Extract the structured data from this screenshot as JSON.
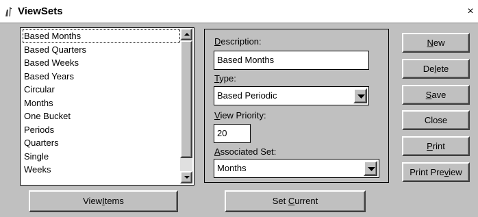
{
  "window": {
    "title": "ViewSets",
    "close_glyph": "×"
  },
  "list": {
    "items": [
      "Based Months",
      "Based Quarters",
      "Based Weeks",
      "Based Years",
      "Circular",
      "Months",
      "One Bucket",
      "Periods",
      "Quarters",
      "Single",
      "Weeks"
    ],
    "selected_index": 0
  },
  "form": {
    "description_label": "Description:",
    "description_value": "Based Months",
    "type_label": "Type:",
    "type_value": "Based Periodic",
    "priority_label": "View Priority:",
    "priority_value": "20",
    "assoc_label": "Associated Set:",
    "assoc_value": "Months"
  },
  "buttons": {
    "new": "New",
    "delete": "Delete",
    "save": "Save",
    "close": "Close",
    "print": "Print",
    "print_preview": "Print Preview",
    "view_items": "ViewItems",
    "set_current": "Set Current"
  },
  "icons": {
    "app": "tool-icon",
    "close": "close-icon",
    "scroll_up": "scroll-up-arrow-icon",
    "scroll_down": "scroll-down-arrow-icon",
    "dropdown": "dropdown-arrow-icon"
  }
}
